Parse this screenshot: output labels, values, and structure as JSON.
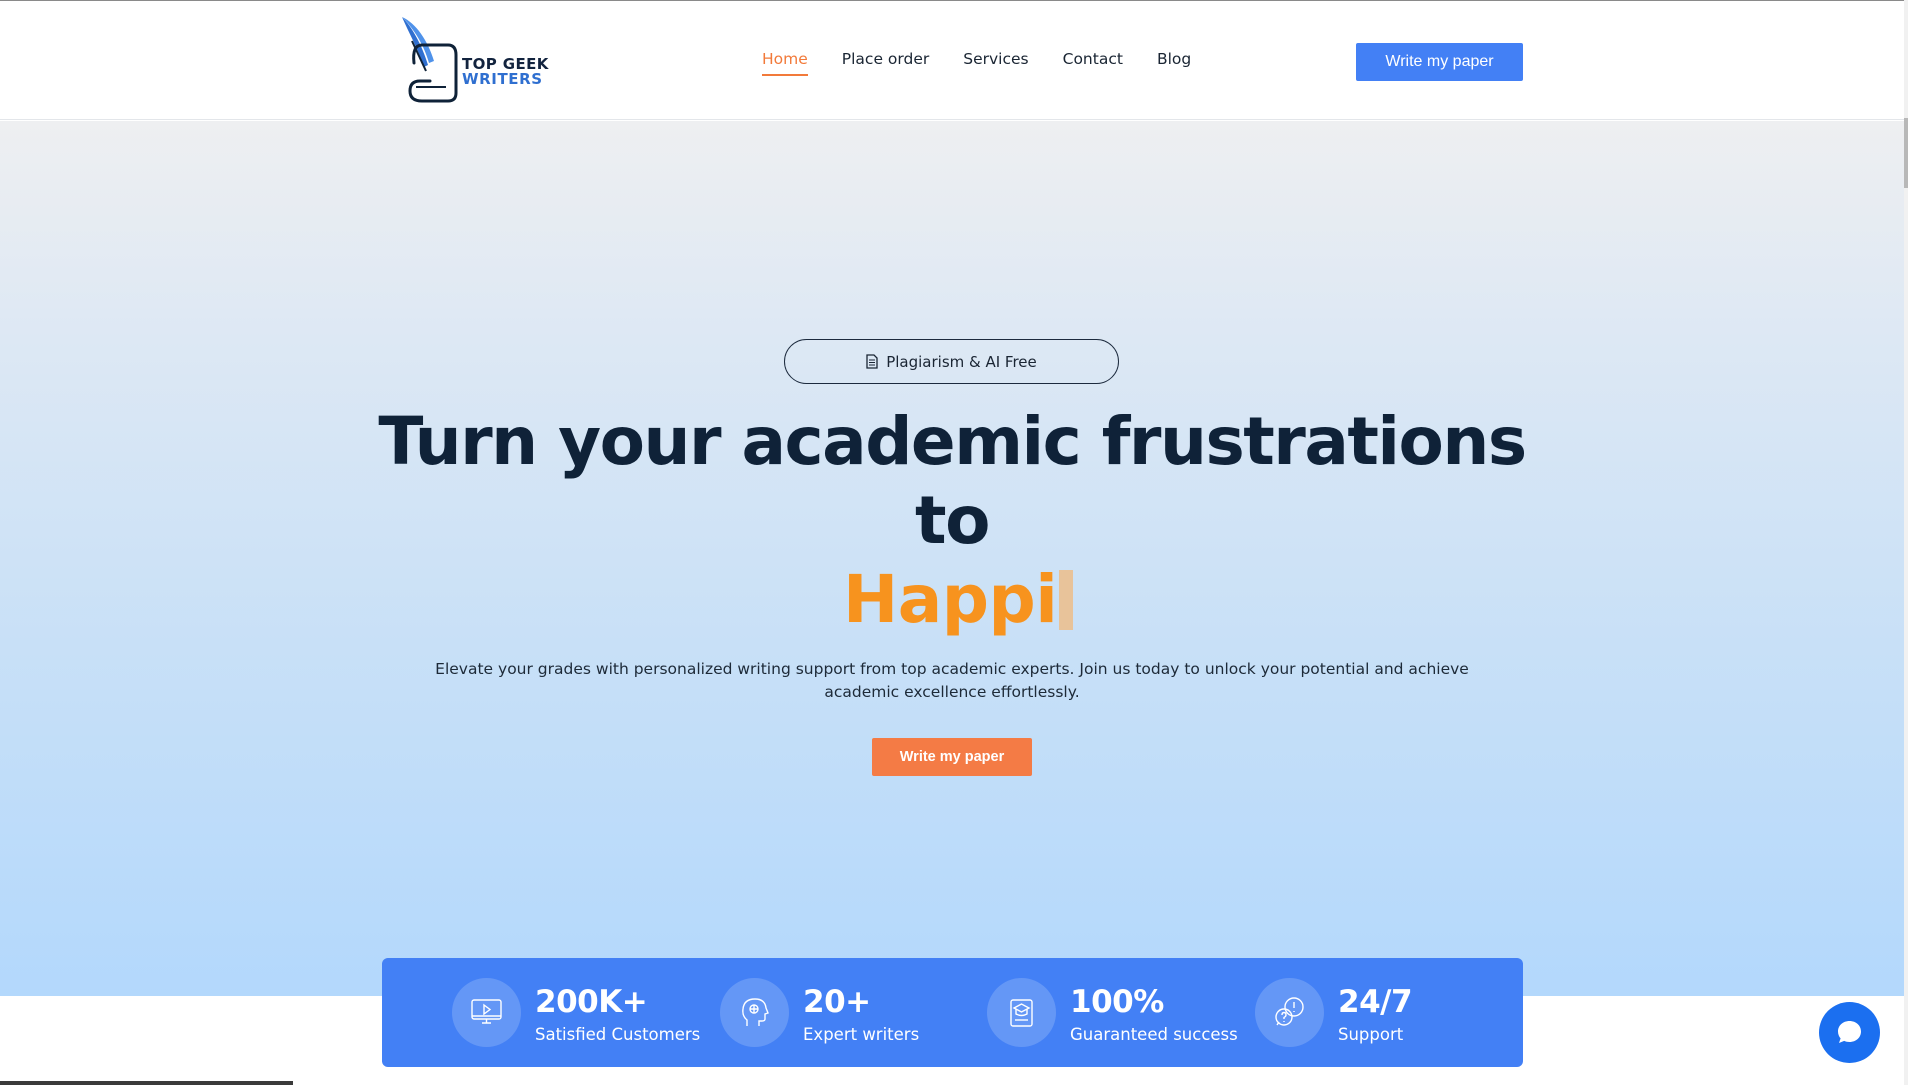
{
  "brand": {
    "line1": "TOP GEEK",
    "line2": "WRITERS"
  },
  "nav": {
    "items": [
      {
        "label": "Home",
        "active": true
      },
      {
        "label": "Place order",
        "active": false
      },
      {
        "label": "Services",
        "active": false
      },
      {
        "label": "Contact",
        "active": false
      },
      {
        "label": "Blog",
        "active": false
      }
    ]
  },
  "header": {
    "cta_label": "Write my paper"
  },
  "hero": {
    "badge": "Plagiarism & AI Free",
    "headline_line1": "Turn your academic frustrations",
    "headline_line2": "to",
    "typed_word": "Happi",
    "subtitle": "Elevate your grades with personalized writing support from top academic experts. Join us today to unlock your potential and achieve academic excellence effortlessly.",
    "cta_label": "Write my paper"
  },
  "stats": [
    {
      "value": "200K+",
      "label": "Satisfied Customers",
      "icon": "monitor-play-icon"
    },
    {
      "value": "20+",
      "label": "Expert writers",
      "icon": "writer-head-icon"
    },
    {
      "value": "100%",
      "label": "Guaranteed success",
      "icon": "graduation-book-icon"
    },
    {
      "value": "24/7",
      "label": "Support",
      "icon": "chat-support-icon"
    }
  ],
  "colors": {
    "primary_blue": "#4380f5",
    "accent_orange": "#f47b45",
    "typed_orange": "#f7931e",
    "navy": "#0f2238"
  }
}
